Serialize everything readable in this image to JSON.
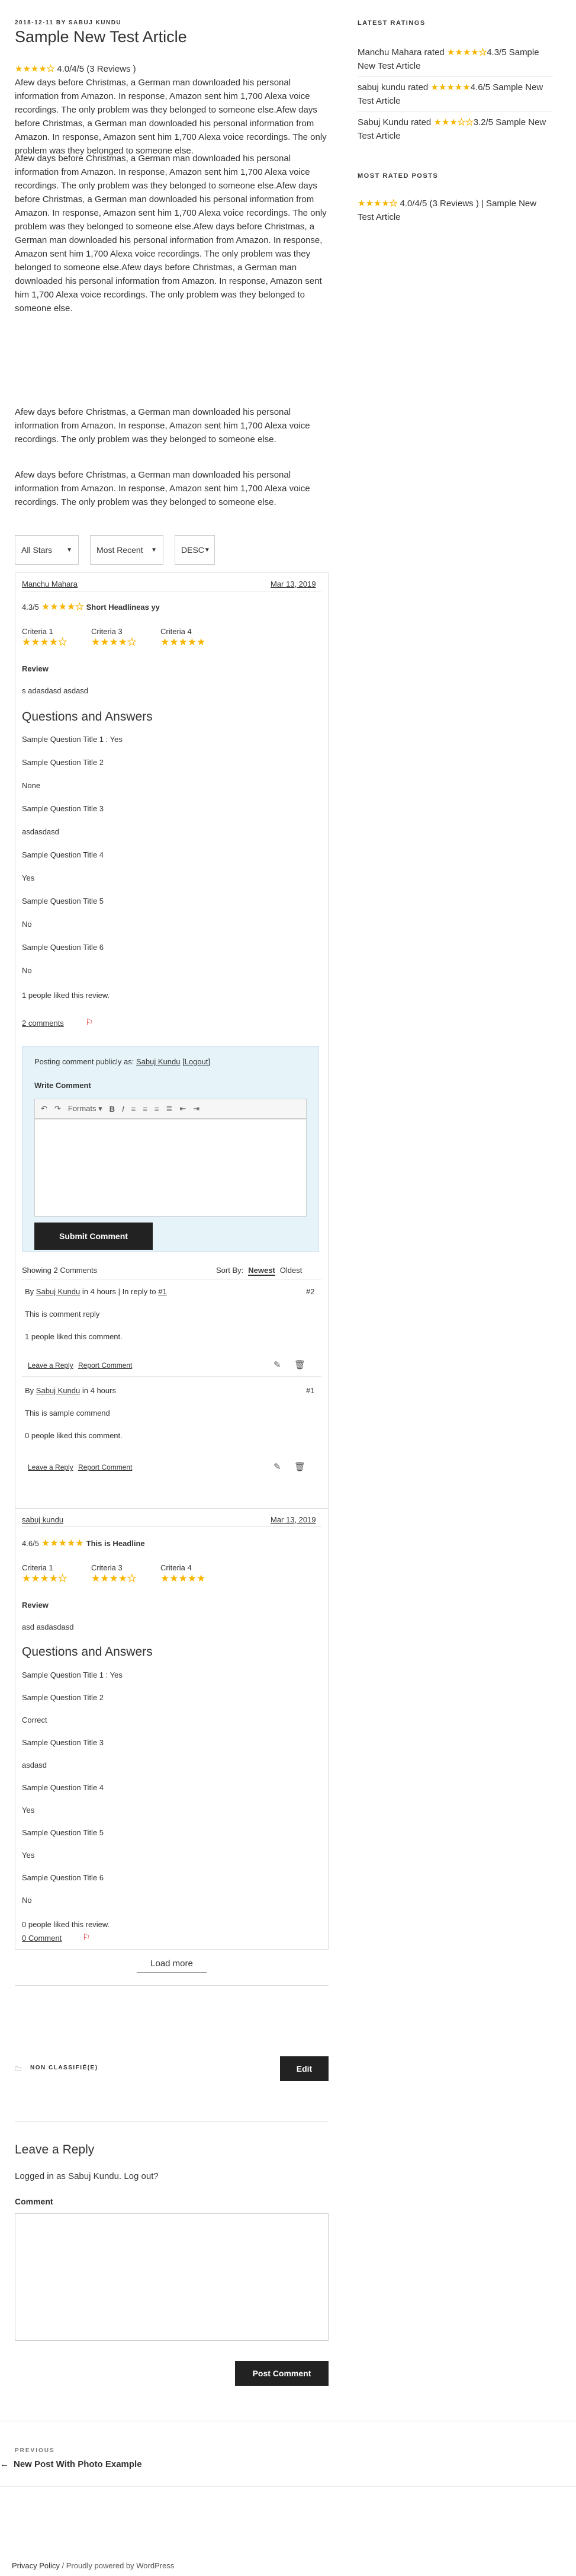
{
  "article": {
    "meta": "2018-12-11 BY SABUJ KUNDU",
    "title": "Sample New Test Article",
    "rating_text": "4.0/4/5 (3 Reviews )",
    "paragraphs": [
      "Afew days before Christmas, a German man downloaded his personal information from Amazon. In response, Amazon sent him 1,700 Alexa voice recordings. The only problem was they belonged to someone else.Afew days before Christmas, a German man downloaded his personal information from Amazon. In response, Amazon sent him 1,700 Alexa voice recordings. The only problem was they belonged to someone else.",
      "Afew days before Christmas, a German man downloaded his personal information from Amazon. In response, Amazon sent him 1,700 Alexa voice recordings. The only problem was they belonged to someone else.Afew days before Christmas, a German man downloaded his personal information from Amazon. In response, Amazon sent him 1,700 Alexa voice recordings. The only problem was they belonged to someone else.Afew days before Christmas, a German man downloaded his personal information from Amazon. In response, Amazon sent him 1,700 Alexa voice recordings. The only problem was they belonged to someone else.Afew days before Christmas, a German man downloaded his personal information from Amazon. In response, Amazon sent him 1,700 Alexa voice recordings. The only problem was they belonged to someone else.",
      "Afew days before Christmas, a German man downloaded his personal information from Amazon. In response, Amazon sent him 1,700 Alexa voice recordings. The only problem was they belonged to someone else.",
      "Afew days before Christmas, a German man downloaded his personal information from Amazon. In response, Amazon sent him 1,700 Alexa voice recordings. The only problem was they belonged to someone else."
    ]
  },
  "sidebar": {
    "latest_title": "LATEST RATINGS",
    "latest": [
      {
        "before": "Manchu Mahara rated",
        "after": "4.3/5 Sample New Test Article"
      },
      {
        "before": "sabuj kundu rated",
        "after": "4.6/5 Sample New Test Article"
      },
      {
        "before": "Sabuj Kundu rated",
        "after": "3.2/5 Sample New Test Article"
      }
    ],
    "most_title": "MOST RATED POSTS",
    "most": {
      "after": "4.0/4/5 (3 Reviews ) | Sample New Test Article"
    }
  },
  "filters": {
    "stars": "All Stars",
    "sort": "Most Recent",
    "order": "DESC"
  },
  "review1": {
    "user": "Manchu Mahara",
    "date": "Mar 13, 2019",
    "score": "4.3/5",
    "headline": "Short Headlineas yy",
    "criteria": [
      "Criteria 1",
      "Criteria 3",
      "Criteria 4"
    ],
    "review_label": "Review",
    "review_text": "s adasdasd asdasd",
    "qa_title": "Questions and Answers",
    "qa": [
      "Sample Question Title 1 : Yes",
      "Sample Question Title 2",
      "None",
      "Sample Question Title 3",
      "asdasdasd",
      "Sample Question Title 4",
      "Yes",
      "Sample Question Title 5",
      "No",
      "Sample Question Title 6",
      "No"
    ],
    "likes": "1 people liked this review.",
    "comments_link": "2 comments"
  },
  "editor": {
    "posting_as": "Posting comment publicly as:",
    "user": "Sabuj Kundu",
    "logout": "[Logout]",
    "write_label": "Write Comment",
    "formats": "Formats",
    "submit": "Submit Comment",
    "showing": "Showing 2 Comments",
    "sort_by": "Sort By:",
    "newest": "Newest",
    "oldest": "Oldest"
  },
  "comments": [
    {
      "by": "By",
      "user": "Sabuj Kundu",
      "when": "in 4 hours | In reply to",
      "reply_ref": "#1",
      "num": "#2",
      "text": "This is comment reply",
      "likes": "1 people liked this comment.",
      "reply": "Leave a Reply",
      "report": "Report Comment"
    },
    {
      "by": "By",
      "user": "Sabuj Kundu",
      "when": "in 4 hours",
      "reply_ref": "",
      "num": "#1",
      "text": "This is sample commend",
      "likes": "0 people liked this comment.",
      "reply": "Leave a Reply",
      "report": "Report Comment"
    }
  ],
  "review2": {
    "user": "sabuj kundu",
    "date": "Mar 13, 2019",
    "score": "4.6/5",
    "headline": "This is Headline",
    "criteria": [
      "Criteria 1",
      "Criteria 3",
      "Criteria 4"
    ],
    "review_label": "Review",
    "review_text": "asd asdasdasd",
    "qa_title": "Questions and Answers",
    "qa": [
      "Sample Question Title 1 : Yes",
      "Sample Question Title 2",
      "Correct",
      "Sample Question Title 3",
      "asdasd",
      "Sample Question Title 4",
      "Yes",
      "Sample Question Title 5",
      "Yes",
      "Sample Question Title 6",
      "No"
    ],
    "likes": "0 people liked this review.",
    "comments_link": "0 Comment"
  },
  "load_more": "Load more",
  "category": "NON CLASSIFIÉ(E)",
  "edit": "Edit",
  "reply_section": {
    "title": "Leave a Reply",
    "logged": "Logged in as Sabuj Kundu. Log out?",
    "comment_label": "Comment",
    "post": "Post Comment"
  },
  "nav": {
    "previous_label": "PREVIOUS",
    "previous_title": "New Post With Photo Example"
  },
  "footer": {
    "privacy": "Privacy Policy",
    "sep": " / ",
    "powered": "Proudly powered by WordPress"
  },
  "colors": {
    "star": "#f7b500",
    "dark": "#222222",
    "editor_bg": "#e6f4fa",
    "flag": "#d33"
  }
}
